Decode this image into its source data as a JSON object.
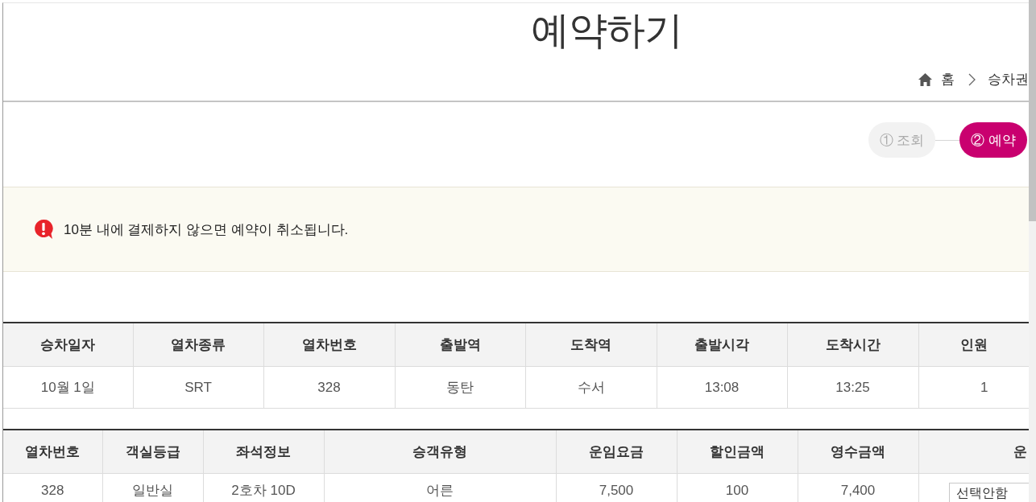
{
  "page": {
    "title": "예약하기"
  },
  "breadcrumb": [
    "홈",
    "승차권"
  ],
  "steps": [
    {
      "label": "① 조회",
      "selected": false
    },
    {
      "label": "② 예약",
      "selected": true
    }
  ],
  "notice": {
    "text": "10분 내에 결제하지 않으면 예약이 취소됩니다."
  },
  "train_table": {
    "columns": [
      "승차일자",
      "열차종류",
      "열차번호",
      "출발역",
      "도착역",
      "출발시각",
      "도착시간",
      "인원"
    ],
    "rows": [
      [
        "10월 1일",
        "SRT",
        "328",
        "동탄",
        "수서",
        "13:08",
        "13:25",
        "1"
      ]
    ]
  },
  "fare_table": {
    "columns": [
      "열차번호",
      "객실등급",
      "좌석정보",
      "승객유형",
      "운임요금",
      "할인금액",
      "영수금액",
      "운"
    ],
    "rows": [
      [
        {
          "kind": "text",
          "value": "328"
        },
        {
          "kind": "text",
          "value": "일반실"
        },
        {
          "kind": "text",
          "value": "2호차 10D"
        },
        {
          "kind": "text",
          "value": "어른"
        },
        {
          "kind": "text",
          "value": "7,500"
        },
        {
          "kind": "text",
          "value": "100"
        },
        {
          "kind": "text",
          "value": "7,400"
        },
        {
          "kind": "select",
          "value": "선택안함"
        }
      ]
    ]
  }
}
